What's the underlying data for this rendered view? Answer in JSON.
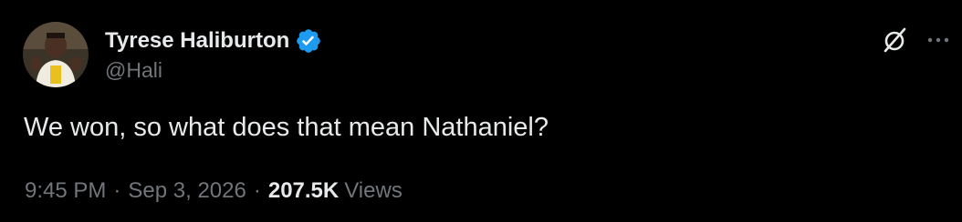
{
  "author": {
    "display_name": "Tyrese Haliburton",
    "handle": "@Hali",
    "verified": true,
    "verified_color": "#1d9bf0"
  },
  "tweet": {
    "text": "We won, so what does that mean Nathaniel?",
    "time": "9:45 PM",
    "separator": "·",
    "date": "Sep 3, 2026",
    "views_count": "207.5K",
    "views_label": "Views"
  },
  "icons": {
    "avatar": "profile-photo",
    "verified": "verified-badge-icon",
    "grok": "grok-icon",
    "more": "more-icon"
  },
  "colors": {
    "background": "#000000",
    "primary_text": "#e7e9ea",
    "secondary_text": "#71767b",
    "accent": "#1d9bf0"
  }
}
